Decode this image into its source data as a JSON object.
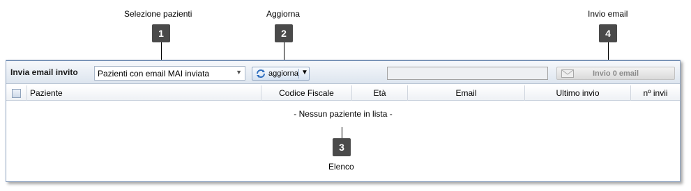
{
  "callouts": [
    {
      "number": "1",
      "title": "Selezione pazienti"
    },
    {
      "number": "2",
      "title": "Aggiorna"
    },
    {
      "number": "3",
      "title": "Elenco"
    },
    {
      "number": "4",
      "title": "Invio email"
    }
  ],
  "toolbar": {
    "title": "Invia email invito",
    "patient_select_value": "Pazienti con email MAI inviata",
    "refresh_label": "aggiorna",
    "send_label": "Invio 0 email"
  },
  "grid": {
    "columns": [
      "Paziente",
      "Codice Fiscale",
      "Età",
      "Email",
      "Ultimo invio",
      "nº invii"
    ],
    "empty_message": "- Nessun paziente in lista -"
  },
  "colors": {
    "badge": "#4a4a4a",
    "panel_border": "#8ea3c0",
    "toolbar_gradient_top": "#f6f8fb",
    "toolbar_gradient_bottom": "#dde5ef"
  },
  "icons": [
    "select-arrow-icon",
    "refresh-icon",
    "dropdown-arrow-icon",
    "email-icon",
    "checkbox-icon"
  ]
}
